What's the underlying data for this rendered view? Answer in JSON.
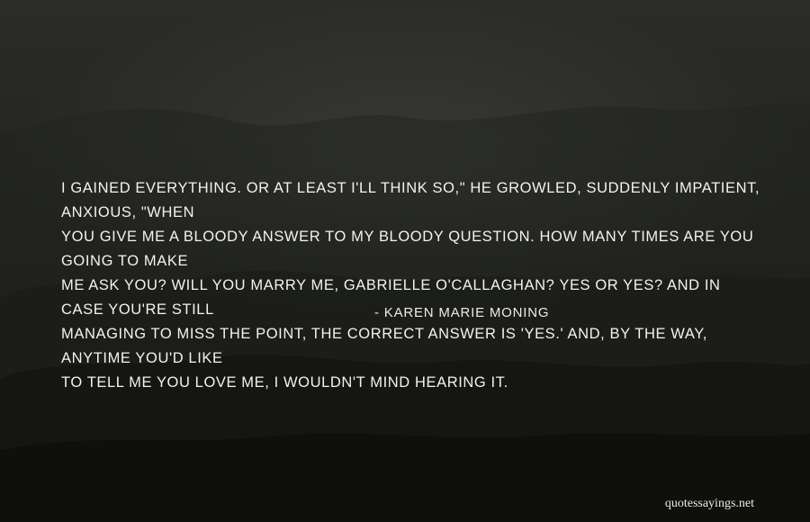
{
  "quote": {
    "text": "I gained everything. Or at least I'll think so,\" he growled, suddenly impatient, anxious, \"When\nyou give me a bloody answer to my bloody question. How many times are you going to make\nme ask you? Will you marry me, Gabrielle O'Callaghan? Yes or yes? And in case you're still\nmanaging to miss the point, the correct answer is 'yes.' And, by the way, anytime you'd like\nto tell me you love me, I wouldn't mind hearing it.",
    "author": "- Karen Marie Moning"
  },
  "watermark": {
    "text": "quotessayings.net"
  }
}
